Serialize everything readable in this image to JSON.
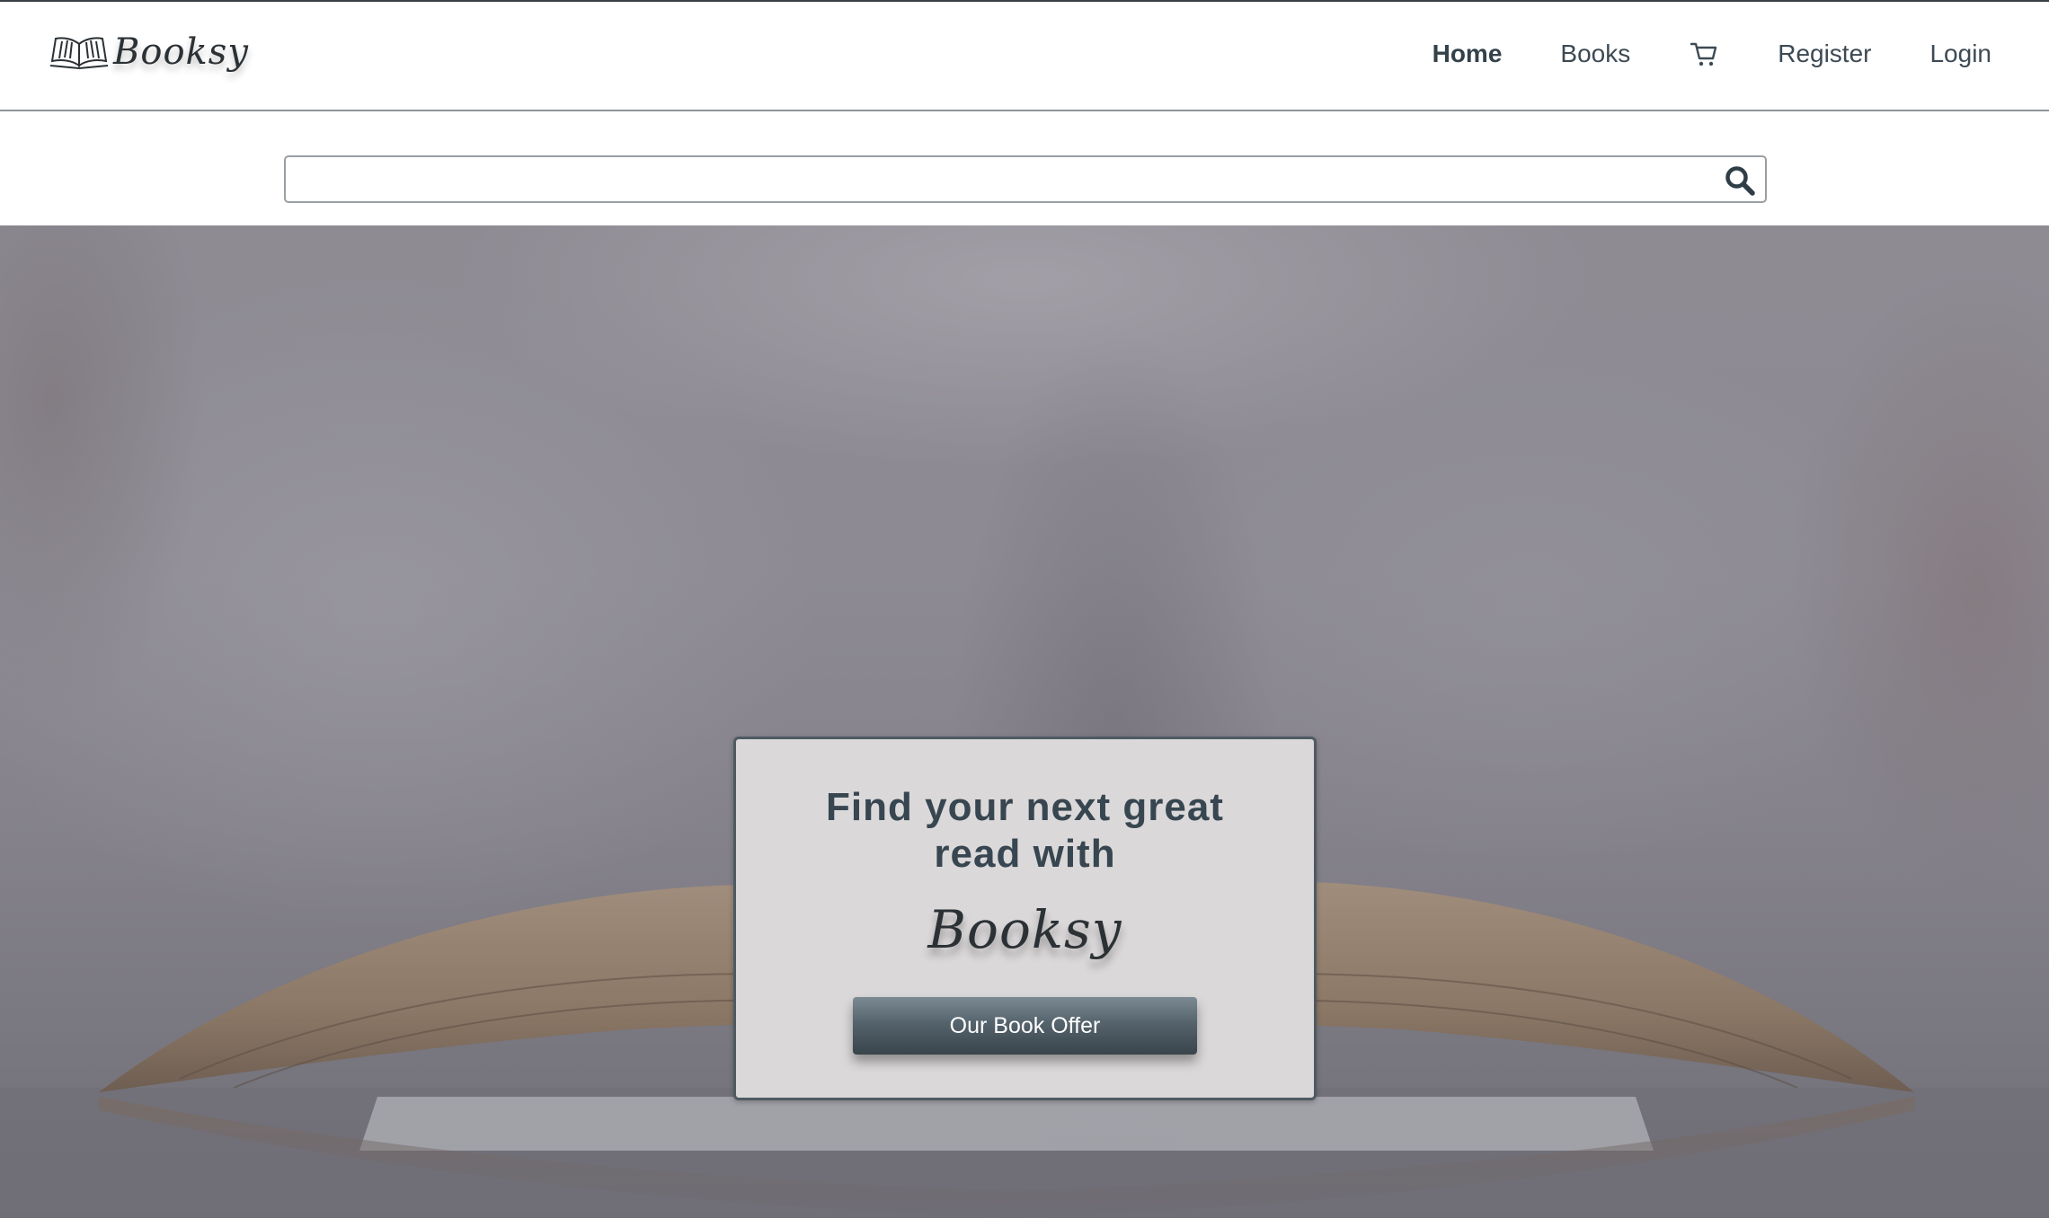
{
  "nav": {
    "brand": "Booksy",
    "links": {
      "home": "Home",
      "books": "Books",
      "register": "Register",
      "login": "Login"
    },
    "cart_icon": "shopping-cart-icon"
  },
  "search": {
    "placeholder": "",
    "value": "",
    "icon": "search-icon"
  },
  "hero": {
    "title": "Find your next great read with",
    "brand": "Booksy",
    "button_label": "Our Book Offer",
    "background": "open-book-photo"
  },
  "colors": {
    "text_dark": "#374650",
    "card_bg": "#dbd8d9",
    "button_top": "#7c8a93",
    "button_bottom": "#39444b"
  }
}
